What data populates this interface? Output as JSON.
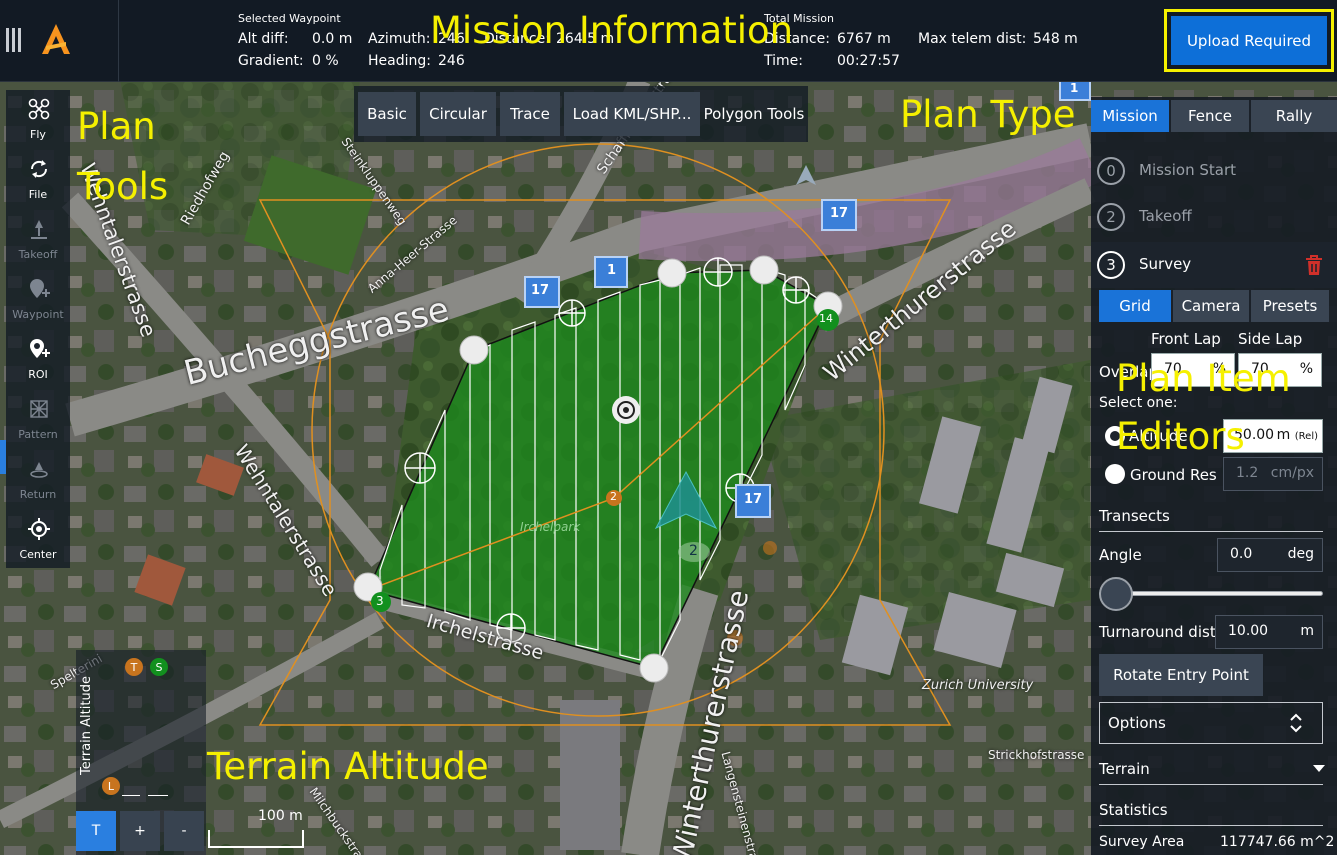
{
  "topbar": {
    "selected_waypoint": {
      "heading": "Selected Waypoint",
      "alt_diff_label": "Alt diff:",
      "alt_diff_value": "0.0 m",
      "gradient_label": "Gradient:",
      "gradient_value": "0 %",
      "azimuth_label": "Azimuth:",
      "azimuth_value": "246",
      "heading_label": "Heading:",
      "heading_value": "246",
      "distance_label": "Distance:",
      "distance_value": "264.5 m"
    },
    "total_mission": {
      "heading": "Total Mission",
      "distance_label": "Distance:",
      "distance_value": "6767 m",
      "time_label": "Time:",
      "time_value": "00:27:57",
      "max_telem_label": "Max telem dist:",
      "max_telem_value": "548 m"
    },
    "upload_button": "Upload Required"
  },
  "annotations": {
    "mission_info": "Mission Information",
    "plan_tools_1": "Plan",
    "plan_tools_2": "Tools",
    "plan_type": "Plan Type",
    "plan_item_1": "Plan Item",
    "plan_item_2": "Editors",
    "terrain_altitude": "Terrain Altitude"
  },
  "toolbar": {
    "items": [
      {
        "label": "Fly",
        "icon": "drone-icon",
        "enabled": true
      },
      {
        "label": "File",
        "icon": "sync-icon",
        "enabled": true
      },
      {
        "label": "Takeoff",
        "icon": "takeoff-icon",
        "enabled": false
      },
      {
        "label": "Waypoint",
        "icon": "waypoint-icon",
        "enabled": false
      },
      {
        "label": "ROI",
        "icon": "roi-icon",
        "enabled": true
      },
      {
        "label": "Pattern",
        "icon": "pattern-icon",
        "enabled": false
      },
      {
        "label": "Return",
        "icon": "return-icon",
        "enabled": false
      },
      {
        "label": "Center",
        "icon": "center-icon",
        "enabled": true
      }
    ]
  },
  "pattern_bar": {
    "basic": "Basic",
    "circular": "Circular",
    "trace": "Trace",
    "load_kml": "Load KML/SHP...",
    "polygon_tools": "Polygon Tools"
  },
  "plan_type_tabs": [
    "Mission",
    "Fence",
    "Rally"
  ],
  "mission_items": [
    {
      "num": "0",
      "label": "Mission Start"
    },
    {
      "num": "2",
      "label": "Takeoff"
    },
    {
      "num": "3",
      "label": "Survey"
    }
  ],
  "survey": {
    "tabs": [
      "Grid",
      "Camera",
      "Presets"
    ],
    "front_lap_label": "Front Lap",
    "side_lap_label": "Side Lap",
    "overlap_label": "Overlap",
    "front_lap_value": "70",
    "side_lap_value": "70",
    "percent": "%",
    "select_one": "Select one:",
    "altitude_label": "Altitude",
    "altitude_value": "50.00",
    "altitude_unit": "m",
    "altitude_ref": "(Rel)",
    "ground_res_label": "Ground Res",
    "ground_res_value": "1.2",
    "ground_res_unit": "cm/px",
    "transects_label": "Transects",
    "angle_label": "Angle",
    "angle_value": "0.0",
    "angle_unit": "deg",
    "turnaround_label": "Turnaround dist",
    "turnaround_value": "10.00",
    "turnaround_unit": "m",
    "rotate_entry": "Rotate Entry Point",
    "options_label": "Options",
    "terrain_label": "Terrain",
    "statistics_label": "Statistics",
    "survey_area_label": "Survey Area",
    "survey_area_value": "117747.66 m^2"
  },
  "map_labels": {
    "bucheggstrasse": "Bucheggstrasse",
    "winterthurerstrasse_ne": "Winterthurerstrasse",
    "winterthurerstrasse_s": "Winterthurerstrasse",
    "wehntalerstrasse_w": "Wehntalerstrasse",
    "wehntalerstrasse_sw": "Wehntalerstrasse",
    "irchelstrasse": "Irchelstrasse",
    "irchelpark": "Irchelpark",
    "zurich_university": "Zurich University",
    "strickhofstrasse": "Strickhofstrasse",
    "anna_heer": "Anna-Heer-Strasse",
    "steinkluppenweg": "Steinkluppenweg",
    "riedhofweg": "Riedhofweg",
    "schaffhauserstrasse": "Schaffhauserstrasse",
    "langensteinenstrasse": "Langensteinenstrasse",
    "milchbuckstrasse": "Milchbuckstrasse",
    "spelterini": "Spelterini",
    "wp_labels": {
      "start": "3",
      "end": "14",
      "mid": "2",
      "camera": "2"
    },
    "badge": "17",
    "badge_one": "1"
  },
  "terrain_panel": {
    "label": "Terrain Altitude",
    "t": "T",
    "s": "S",
    "l": "L",
    "btn_t": "T",
    "btn_plus": "+",
    "btn_minus": "-"
  },
  "scale": {
    "label": "100 m"
  },
  "colors": {
    "accent": "#1a73d8",
    "upload": "#0d6fd8",
    "annotation": "#f5f000",
    "survey_fill": "#1d8a1d",
    "orange": "#e09020"
  }
}
